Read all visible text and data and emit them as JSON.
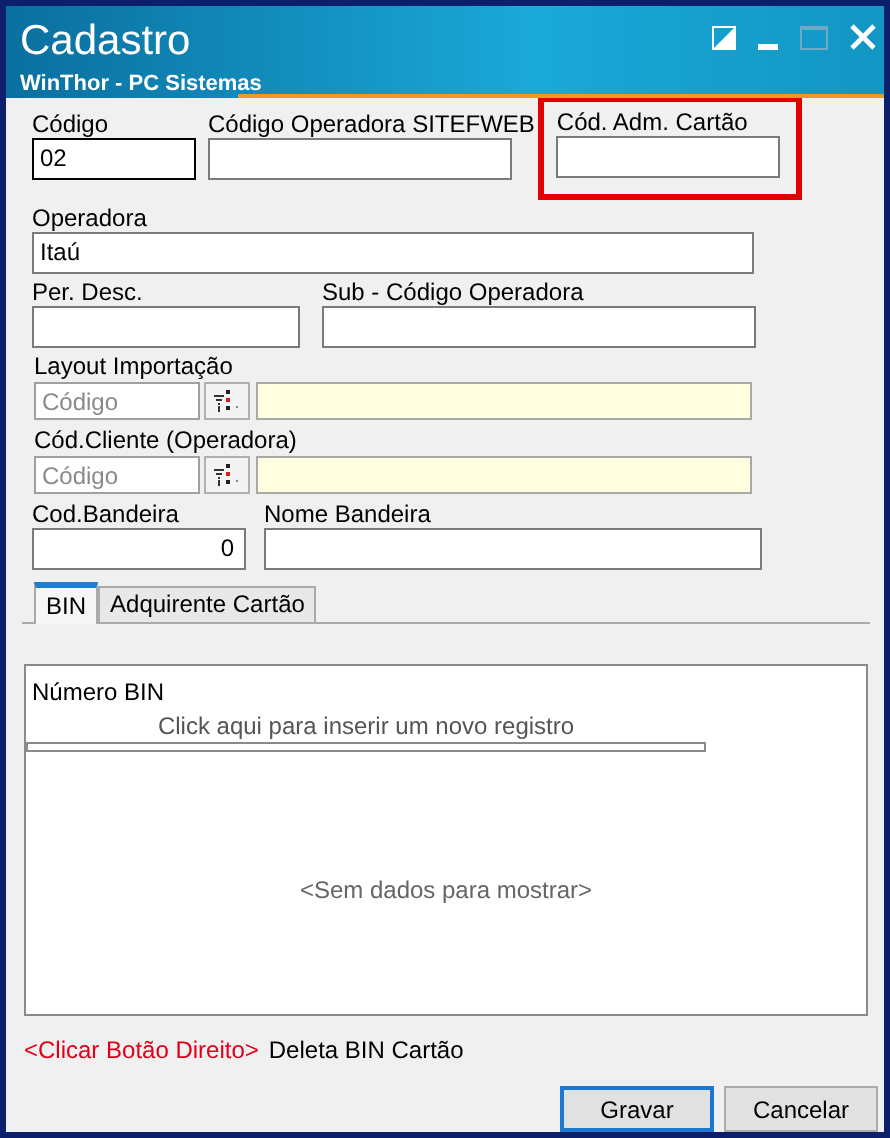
{
  "window": {
    "title": "Cadastro",
    "subtitle": "WinThor - PC Sistemas"
  },
  "rows": [
    [
      {
        "kind": "text",
        "label": "Código",
        "value": "02",
        "focused": true,
        "highlighted": false
      },
      {
        "kind": "text",
        "label": "Código  Operadora SITEFWEB",
        "focused": false,
        "highlighted": false
      },
      {
        "kind": "text",
        "label": "Cód. Adm. Cartão",
        "focused": false,
        "highlighted": true
      }
    ],
    [
      {
        "kind": "text",
        "label": "Operadora",
        "value": "Itaú",
        "focused": false,
        "highlighted": false
      }
    ],
    [
      {
        "kind": "text",
        "label": "Per. Desc.",
        "focused": false,
        "highlighted": false
      },
      {
        "kind": "text",
        "label": "Sub - Código Operadora",
        "focused": false,
        "highlighted": false
      }
    ],
    [
      {
        "kind": "lookup",
        "label": "Layout Importação",
        "placeholder": "Código",
        "focused": false,
        "highlighted": false
      }
    ],
    [
      {
        "kind": "lookup",
        "label": "Cód.Cliente (Operadora)",
        "placeholder": "Código",
        "focused": false,
        "highlighted": false
      }
    ],
    [
      {
        "kind": "number",
        "label": "Cod.Bandeira",
        "value": "0",
        "focused": false,
        "highlighted": false
      },
      {
        "kind": "text",
        "label": "Nome Bandeira",
        "focused": false,
        "highlighted": false
      }
    ]
  ],
  "tabs": [
    {
      "label": "BIN",
      "selected": true
    },
    {
      "label": "Adquirente Cartão",
      "selected": false
    }
  ],
  "grid": {
    "column": "Número BIN",
    "new_row_hint": "Click aqui para inserir um novo registro",
    "empty_text": "<Sem dados para mostrar>"
  },
  "hint": {
    "action": "<Clicar Botão Direito>",
    "description": "Deleta BIN Cartão"
  },
  "buttons": [
    {
      "label": "Gravar",
      "focused": true
    },
    {
      "label": "Cancelar",
      "focused": false
    }
  ]
}
